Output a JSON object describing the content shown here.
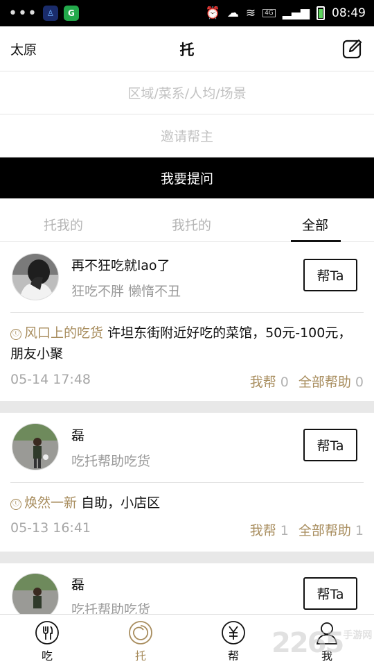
{
  "status_bar": {
    "dots": "•••",
    "app_icon_1": "♙",
    "app_icon_2": "G",
    "network": "4G",
    "time": "08:49"
  },
  "nav": {
    "city": "太原",
    "title": "托",
    "compose_icon": "edit-icon"
  },
  "form": {
    "area_placeholder": "区域/菜系/人均/场景",
    "invite_placeholder": "邀请帮主",
    "ask_button": "我要提问"
  },
  "tabs": [
    {
      "label": "托我的",
      "active": false
    },
    {
      "label": "我托的",
      "active": false
    },
    {
      "label": "全部",
      "active": true
    }
  ],
  "posts": [
    {
      "user_name": "再不狂吃就lao了",
      "user_bio": "狂吃不胖 懒惰不丑",
      "help_button": "帮Ta",
      "coin_icon": "ⓣ",
      "asker": "风口上的吃货",
      "question": "许坦东街附近好吃的菜馆，50元-100元，朋友小聚",
      "time": "05-14 17:48",
      "my_help_label": "我帮",
      "my_help_count": "0",
      "all_help_label": "全部帮助",
      "all_help_count": "0"
    },
    {
      "user_name": "磊",
      "user_bio": "吃托帮助吃货",
      "help_button": "帮Ta",
      "coin_icon": "ⓣ",
      "asker": "焕然一新",
      "question": "自助，小店区",
      "time": "05-13 16:41",
      "my_help_label": "我帮",
      "my_help_count": "1",
      "all_help_label": "全部帮助",
      "all_help_count": "1"
    },
    {
      "user_name": "磊",
      "user_bio": "吃托帮助吃货",
      "help_button": "帮Ta"
    }
  ],
  "bottom_nav": [
    {
      "label": "吃",
      "icon": "fork-icon",
      "active": false
    },
    {
      "label": "托",
      "icon": "spiral-icon",
      "active": true
    },
    {
      "label": "帮",
      "icon": "yen-icon",
      "active": false
    },
    {
      "label": "我",
      "icon": "person-icon",
      "active": false
    }
  ],
  "watermark": {
    "text": "2265",
    "sub": "手游网"
  },
  "colors": {
    "accent": "#a88d5e",
    "black": "#000000",
    "muted": "#9a9a9a",
    "separator": "#e8e8e8"
  }
}
